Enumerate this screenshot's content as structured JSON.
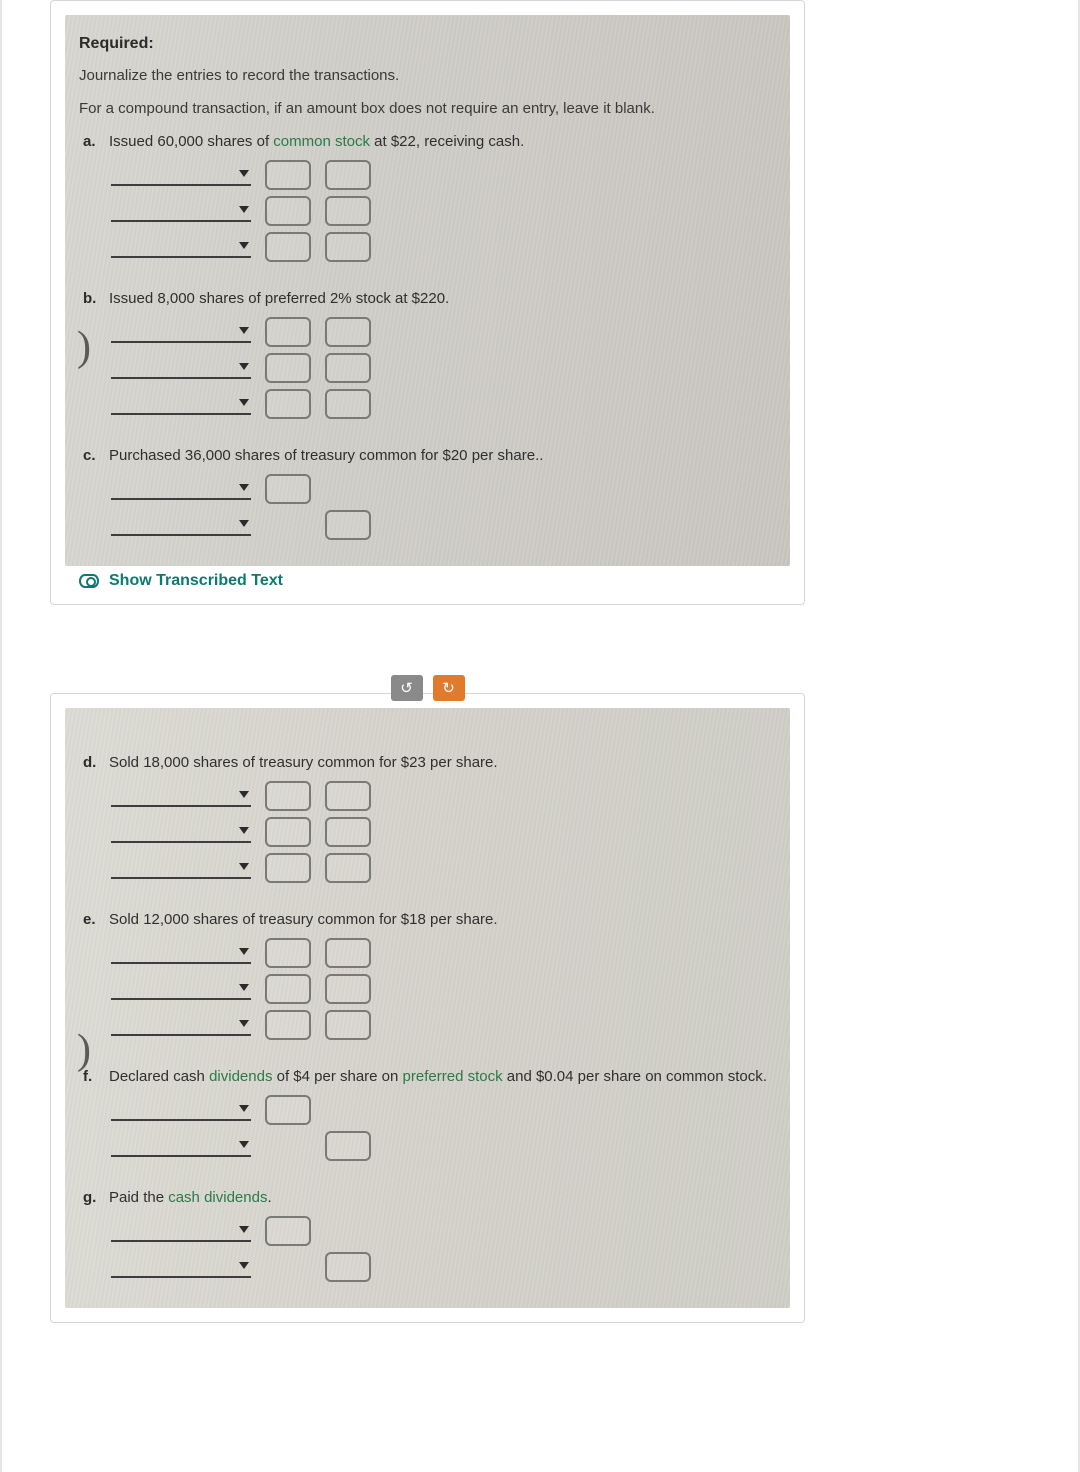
{
  "image1": {
    "required_label": "Required:",
    "instruction1": "Journalize the entries to record the transactions.",
    "instruction2": "For a compound transaction, if an amount box does not require an entry, leave it blank.",
    "items": {
      "a": {
        "letter": "a.",
        "text_pre": "Issued 60,000 shares of ",
        "term": "common stock",
        "text_post": " at $22, receiving cash."
      },
      "b": {
        "letter": "b.",
        "text": "Issued 8,000 shares of preferred 2% stock at $220."
      },
      "c": {
        "letter": "c.",
        "text": "Purchased 36,000 shares of treasury common for $20 per share.."
      }
    }
  },
  "show_transcribed": "Show Transcribed Text",
  "buttons": {
    "undo": "↺",
    "redo": "↻"
  },
  "image2": {
    "items": {
      "d": {
        "letter": "d.",
        "text": "Sold 18,000 shares of treasury common for $23 per share."
      },
      "e": {
        "letter": "e.",
        "text": "Sold 12,000 shares of treasury common for $18 per share."
      },
      "f": {
        "letter": "f.",
        "pre": "Declared cash ",
        "term1": "dividends",
        "mid": " of $4 per share on ",
        "term2": "preferred stock",
        "post": " and $0.04 per share on common stock."
      },
      "g": {
        "letter": "g.",
        "pre": "Paid the ",
        "term": "cash dividends",
        "post": "."
      }
    }
  }
}
